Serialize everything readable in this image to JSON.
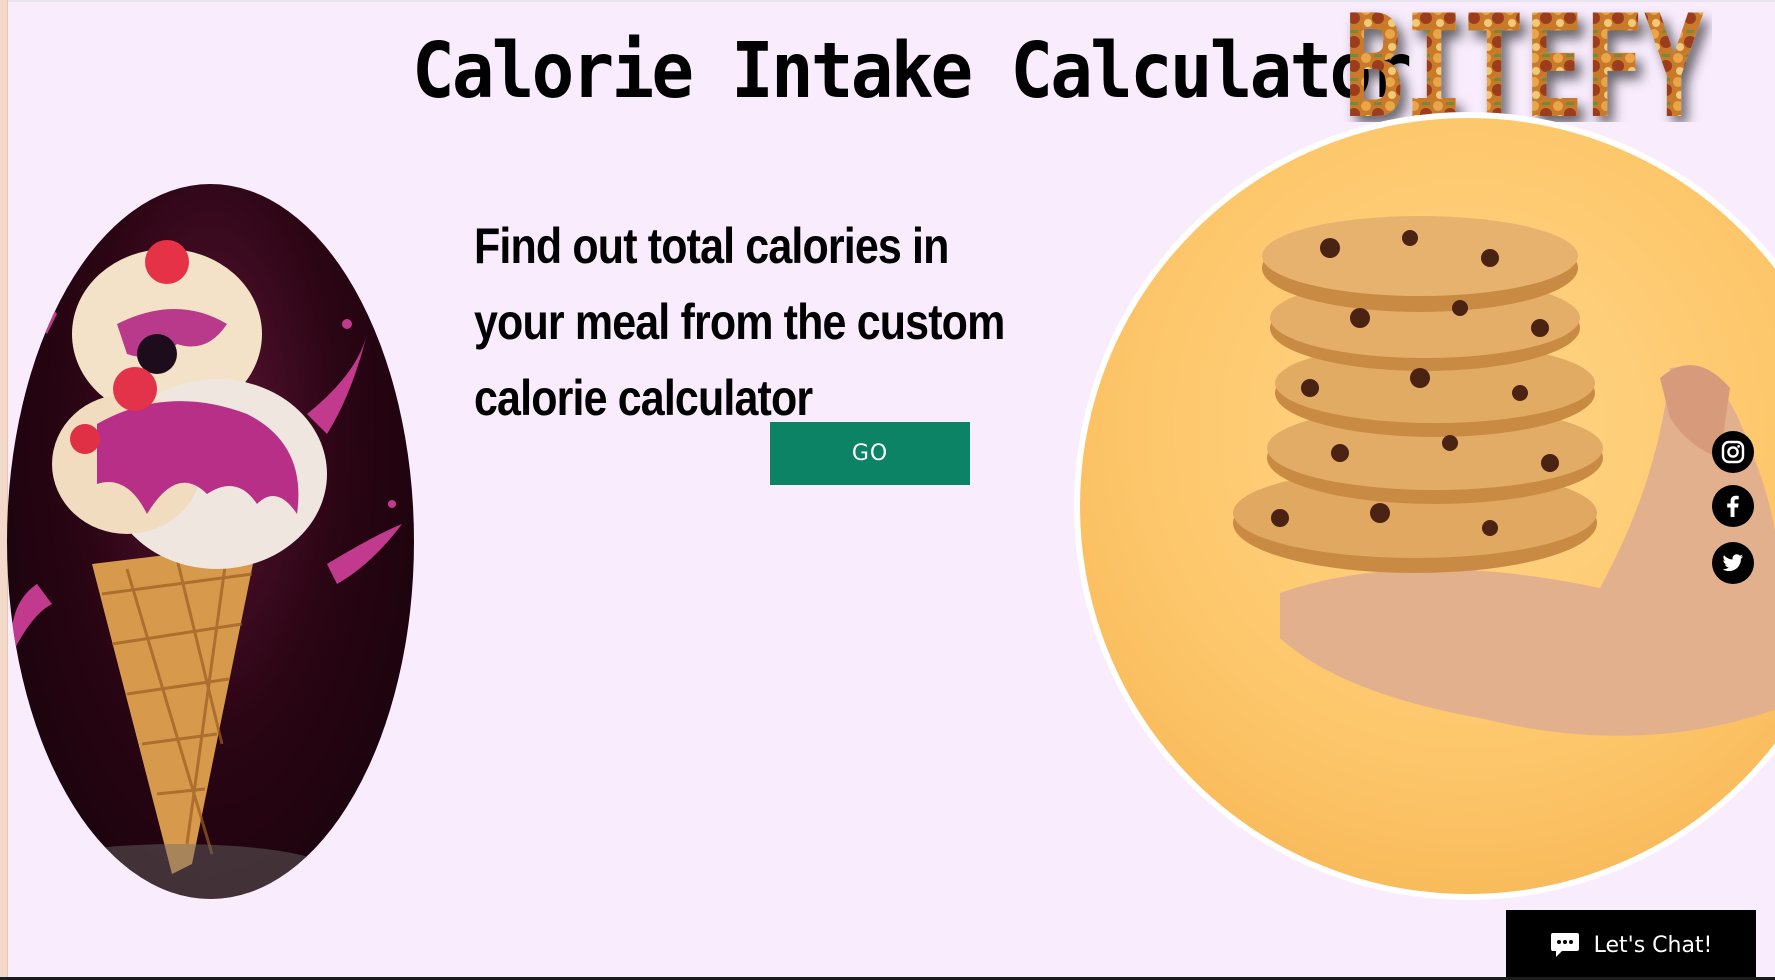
{
  "header": {
    "title": "Calorie Intake Calculator",
    "brand": "BITEFY"
  },
  "hero": {
    "headline": "Find out  total calories in your meal from the custom calorie calculator",
    "go_label": "GO"
  },
  "images": {
    "left": "ice cream cone with berries",
    "right": "stack of chocolate chip cookies in hand"
  },
  "social": {
    "items": [
      "instagram-icon",
      "facebook-icon",
      "twitter-icon"
    ]
  },
  "chat": {
    "label": "Let's Chat!"
  },
  "colors": {
    "background": "#f8ecfd",
    "button": "#0b8364",
    "chat": "#000000"
  }
}
